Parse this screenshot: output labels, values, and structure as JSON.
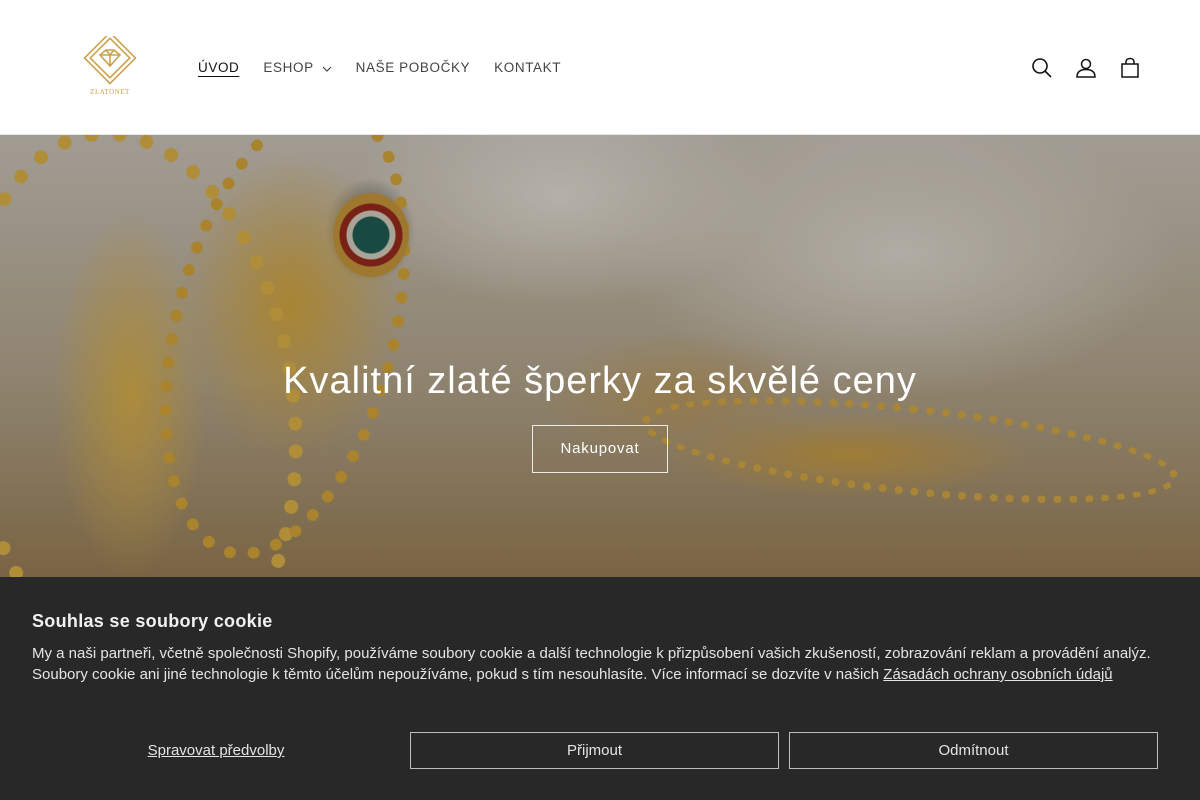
{
  "header": {
    "logo_text": "ZLATONET",
    "nav": [
      {
        "label": "ÚVOD",
        "active": true
      },
      {
        "label": "ESHOP",
        "has_dropdown": true
      },
      {
        "label": "NAŠE POBOČKY"
      },
      {
        "label": "KONTAKT"
      }
    ],
    "icons": [
      "search-icon",
      "account-icon",
      "cart-icon"
    ]
  },
  "hero": {
    "title": "Kvalitní zlaté šperky za skvělé ceny",
    "button_label": "Nakupovat"
  },
  "cookie_banner": {
    "title": "Souhlas se soubory cookie",
    "text": "My a naši partneři, včetně společnosti Shopify, používáme soubory cookie a další technologie k přizpůsobení vašich zkušeností, zobrazování reklam a provádění analýz. Soubory cookie ani jiné technologie k těmto účelům nepoužíváme, pokud s tím nesouhlasíte. Více informací se dozvíte v našich ",
    "policy_link": "Zásadách ochrany osobních údajů",
    "manage_label": "Spravovat předvolby",
    "accept_label": "Přijmout",
    "decline_label": "Odmítnout"
  },
  "colors": {
    "brand_gold": "#c9a24d",
    "banner_bg": "#282828"
  }
}
